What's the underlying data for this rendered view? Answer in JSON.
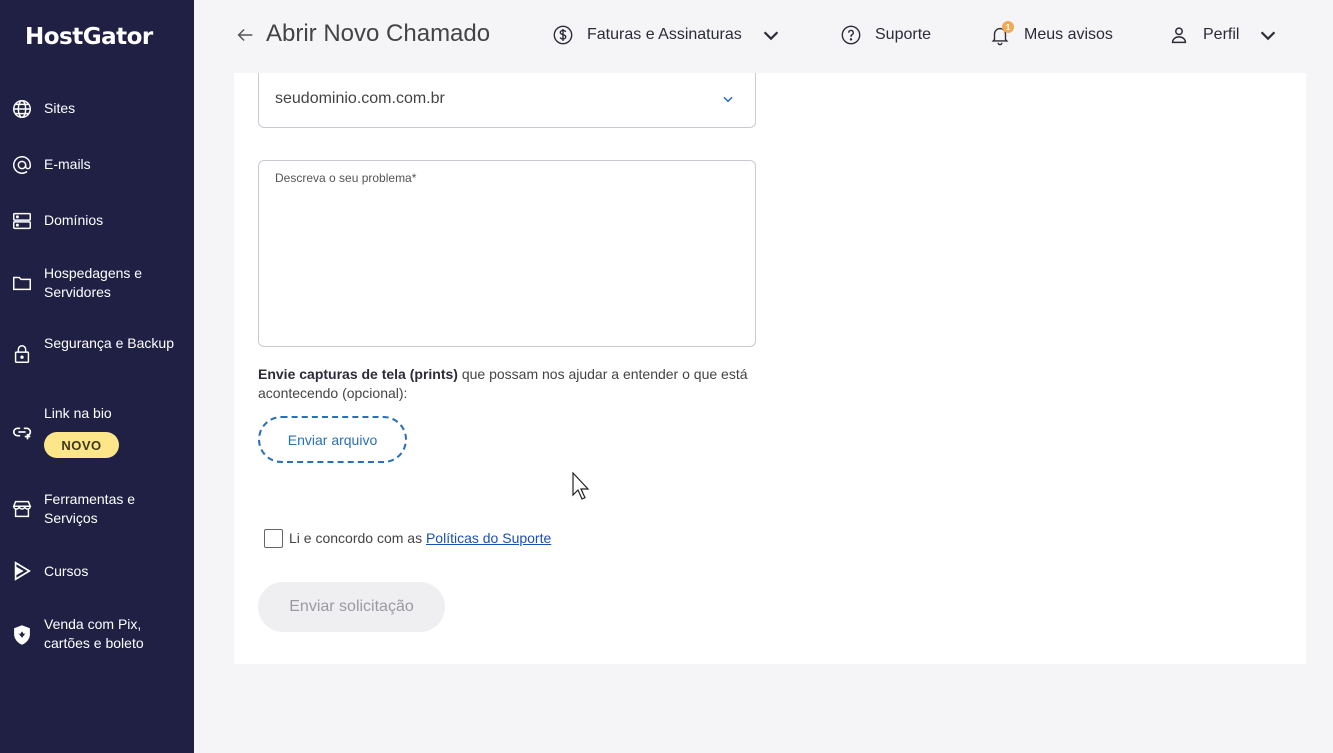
{
  "brand": {
    "logo": "HostGator"
  },
  "sidebar": {
    "items": [
      {
        "label": "Sites",
        "icon": "globe-icon"
      },
      {
        "label": "E-mails",
        "icon": "at-icon"
      },
      {
        "label": "Domínios",
        "icon": "server-icon"
      },
      {
        "label": "Hospedagens e Servidores",
        "icon": "folder-icon"
      },
      {
        "label": "Segurança e Backup",
        "icon": "lock-icon"
      },
      {
        "label": "Link na bio",
        "icon": "link-icon",
        "badge": "NOVO"
      },
      {
        "label": "Ferramentas e Serviços",
        "icon": "store-icon"
      },
      {
        "label": "Cursos",
        "icon": "play-icon"
      },
      {
        "label": "Venda com Pix, cartões e boleto",
        "icon": "shield-icon"
      }
    ]
  },
  "header": {
    "title": "Abrir Novo Chamado",
    "billing": "Faturas e Assinaturas",
    "support": "Suporte",
    "notices": "Meus avisos",
    "notices_count": "1",
    "profile": "Perfil"
  },
  "form": {
    "domain_value": "seudominio.com.com.br",
    "description_label": "Descreva o seu problema*",
    "upload_bold": "Envie capturas de tela (prints)",
    "upload_rest": " que possam nos ajudar a entender o que está acontecendo (opcional):",
    "upload_button": "Enviar arquivo",
    "terms_prefix": "Li e concordo com as ",
    "terms_link": "Políticas do Suporte",
    "submit": "Enviar solicitação"
  },
  "colors": {
    "sidebar_bg": "#1f2044",
    "badge_bg": "#fde58a",
    "link": "#1a4fb5",
    "upload_border": "#2a70b8",
    "notification": "#f0a955"
  }
}
